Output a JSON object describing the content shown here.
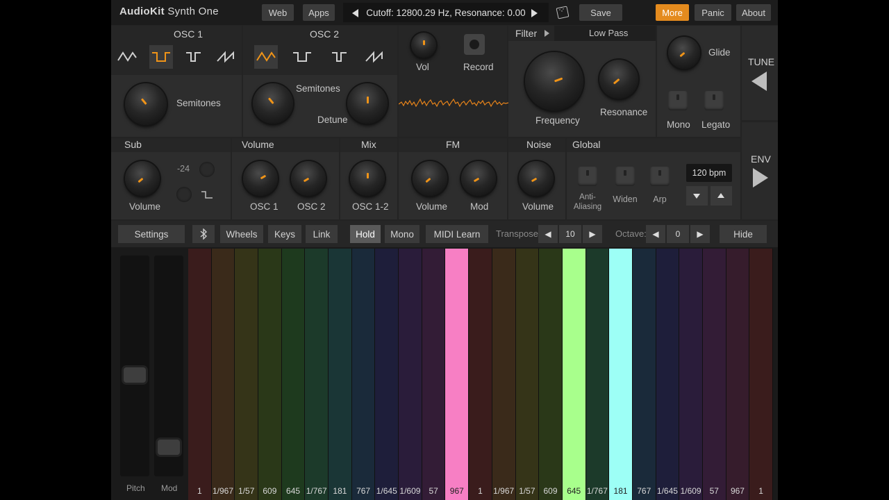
{
  "app": {
    "logo_bold": "AudioKit",
    "logo_rest": " Synth One"
  },
  "topbar": {
    "web": "Web",
    "apps": "Apps",
    "preset_text": "Cutoff: 12800.29 Hz, Resonance: 0.00",
    "save": "Save",
    "more": "More",
    "panic": "Panic",
    "about": "About"
  },
  "osc1": {
    "title": "OSC 1",
    "semitones": "Semitones"
  },
  "osc2": {
    "title": "OSC 2",
    "semitones": "Semitones",
    "detune": "Detune"
  },
  "master": {
    "vol": "Vol",
    "record": "Record"
  },
  "filter": {
    "title": "Filter",
    "type": "Low Pass",
    "frequency": "Frequency",
    "resonance": "Resonance"
  },
  "glide": {
    "glide": "Glide",
    "mono": "Mono",
    "legato": "Legato"
  },
  "side": {
    "tune": "TUNE",
    "env": "ENV"
  },
  "sub": {
    "title": "Sub",
    "volume": "Volume",
    "octave": "-24"
  },
  "volume": {
    "title": "Volume",
    "osc1": "OSC 1",
    "osc2": "OSC 2"
  },
  "mix": {
    "title": "Mix",
    "osc12": "OSC 1-2"
  },
  "fm": {
    "title": "FM",
    "volume": "Volume",
    "mod": "Mod"
  },
  "noise": {
    "title": "Noise",
    "volume": "Volume"
  },
  "global": {
    "title": "Global",
    "antialias": "Anti-\nAliasing",
    "widen": "Widen",
    "arp": "Arp",
    "bpm": "120 bpm"
  },
  "toolbar": {
    "settings": "Settings",
    "wheels": "Wheels",
    "keys": "Keys",
    "link": "Link",
    "hold": "Hold",
    "mono": "Mono",
    "midi_learn": "MIDI Learn",
    "transpose_label": "Transpose:",
    "transpose_value": "10",
    "octave_label": "Octave:",
    "octave_value": "0",
    "hide": "Hide"
  },
  "wheels": {
    "pitch": "Pitch",
    "mod": "Mod"
  },
  "keyboard": {
    "keys": [
      {
        "label": "1",
        "color": "#3a1c1c"
      },
      {
        "label": "1/967",
        "color": "#3a2a1a"
      },
      {
        "label": "1/57",
        "color": "#353418"
      },
      {
        "label": "609",
        "color": "#2a3818"
      },
      {
        "label": "645",
        "color": "#1e3a1e"
      },
      {
        "label": "1/767",
        "color": "#1c3a2a"
      },
      {
        "label": "181",
        "color": "#1a3636"
      },
      {
        "label": "767",
        "color": "#1a2a3a"
      },
      {
        "label": "1/645",
        "color": "#1e1e3a"
      },
      {
        "label": "1/609",
        "color": "#2a1c3a"
      },
      {
        "label": "57",
        "color": "#331c36"
      },
      {
        "label": "967",
        "color": "#f77fc4"
      },
      {
        "label": "1",
        "color": "#3a1c1c"
      },
      {
        "label": "1/967",
        "color": "#3a2a1a"
      },
      {
        "label": "1/57",
        "color": "#353418"
      },
      {
        "label": "609",
        "color": "#2a3818"
      },
      {
        "label": "645",
        "color": "#a8ff8c"
      },
      {
        "label": "1/767",
        "color": "#1c3a2a"
      },
      {
        "label": "181",
        "color": "#9dfff6"
      },
      {
        "label": "767",
        "color": "#1a2a3a"
      },
      {
        "label": "1/645",
        "color": "#1e1e3a"
      },
      {
        "label": "1/609",
        "color": "#2a1c3a"
      },
      {
        "label": "57",
        "color": "#331c36"
      },
      {
        "label": "967",
        "color": "#361c2c"
      },
      {
        "label": "1",
        "color": "#3a1c1c"
      }
    ]
  },
  "colors": {
    "accent": "#f09418",
    "more_button": "#e48b1e"
  }
}
